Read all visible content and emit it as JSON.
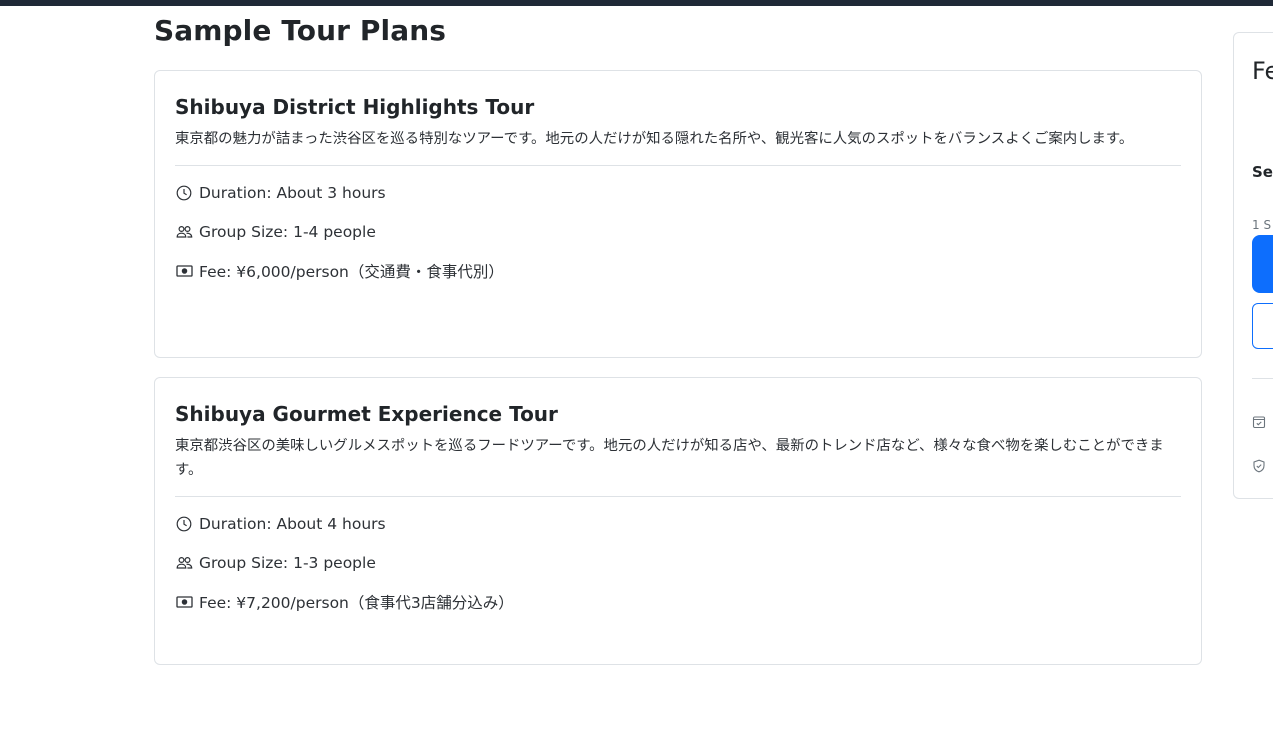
{
  "main": {
    "section_title": "Sample Tour Plans",
    "tours": [
      {
        "title": "Shibuya District Highlights Tour",
        "description": "東京都の魅力が詰まった渋谷区を巡る特別なツアーです。地元の人だけが知る隠れた名所や、観光客に人気のスポットをバランスよくご案内します。",
        "duration": "Duration: About 3 hours",
        "group_size": "Group Size: 1-4 people",
        "fee": "Fee: ¥6,000/person（交通費・食事代別）"
      },
      {
        "title": "Shibuya Gourmet Experience Tour",
        "description": "東京都渋谷区の美味しいグルメスポットを巡るフードツアーです。地元の人だけが知る店や、最新のトレンド店など、様々な食べ物を楽しむことができます。",
        "duration": "Duration: About 4 hours",
        "group_size": "Group Size: 1-3 people",
        "fee": "Fee: ¥7,200/person（食事代3店舗分込み）"
      }
    ]
  },
  "sidebar": {
    "title": "Fe",
    "subtitle": "Se",
    "small_text": "1 S"
  },
  "icons": {
    "duration": "clock-icon",
    "group_size": "people-icon",
    "fee": "cash-icon",
    "sidebar_1": "calendar-check-icon",
    "sidebar_2": "shield-check-icon"
  },
  "colors": {
    "primary": "#0d6efd",
    "topbar": "#1f2937",
    "border": "#dee2e6"
  }
}
